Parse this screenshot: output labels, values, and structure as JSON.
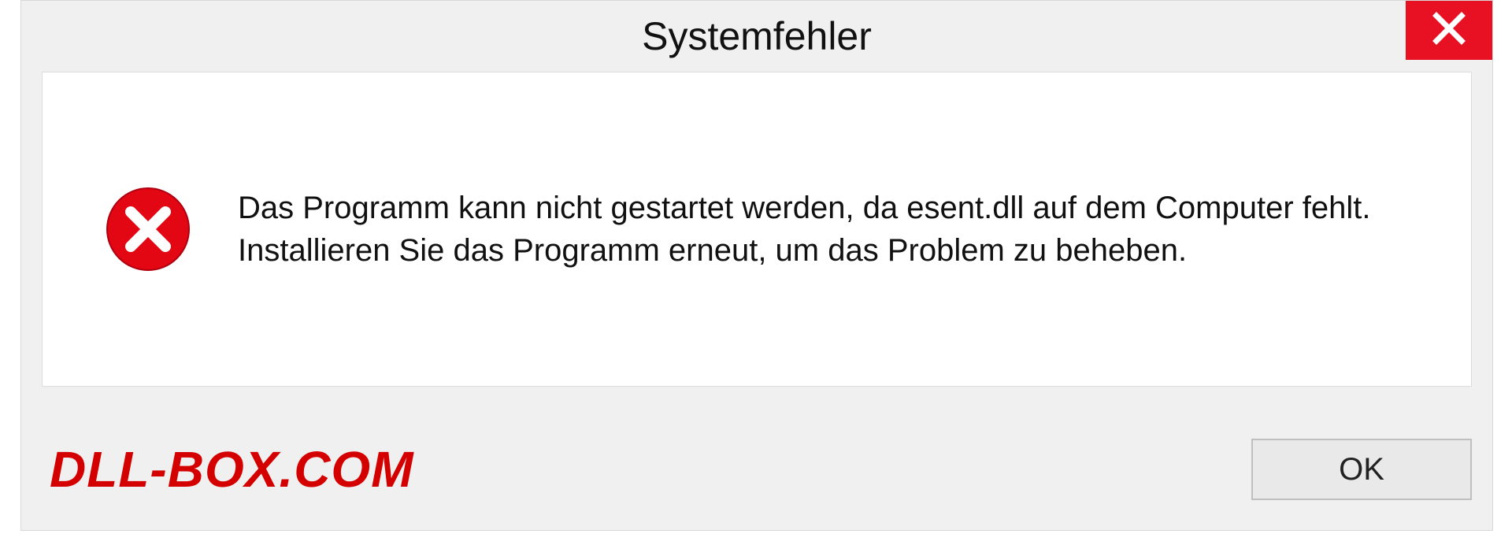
{
  "dialog": {
    "title": "Systemfehler",
    "message": "Das Programm kann nicht gestartet werden, da esent.dll auf dem Computer fehlt. Installieren Sie das Programm erneut, um das Problem zu beheben.",
    "ok_label": "OK"
  },
  "watermark": "DLL-BOX.COM",
  "icons": {
    "close": "close-icon",
    "error": "error-icon"
  }
}
